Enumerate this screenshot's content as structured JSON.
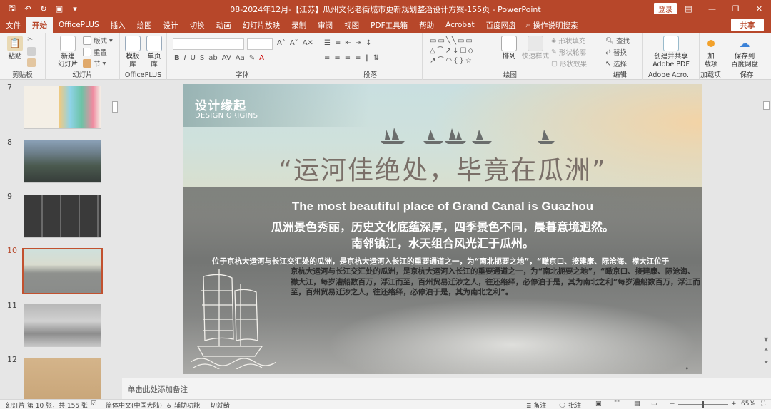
{
  "window": {
    "title": "08-2024年12月-【江苏】瓜州文化老街城市更新规划整治设计方案-155页  -  PowerPoint",
    "login": "登录",
    "share": "共享"
  },
  "tabs": [
    "文件",
    "开始",
    "OfficePLUS",
    "插入",
    "绘图",
    "设计",
    "切换",
    "动画",
    "幻灯片放映",
    "录制",
    "审阅",
    "视图",
    "PDF工具箱",
    "帮助",
    "Acrobat",
    "百度网盘"
  ],
  "active_tab": "开始",
  "tell_me": "操作说明搜索",
  "ribbon": {
    "clipboard": {
      "label": "剪贴板",
      "paste": "粘贴"
    },
    "slides": {
      "label": "幻灯片",
      "new_slide": "新建\n幻灯片",
      "layout": "版式",
      "reset": "重置",
      "section": "节"
    },
    "officeplus": {
      "label": "OfficePLUS",
      "template": "模板库",
      "single": "单页库"
    },
    "font": {
      "label": "字体"
    },
    "paragraph": {
      "label": "段落"
    },
    "drawing": {
      "label": "绘图",
      "arrange": "排列",
      "quick_styles": "快速样式",
      "fill": "形状填充",
      "outline": "形状轮廓",
      "effects": "形状效果"
    },
    "editing": {
      "label": "编辑",
      "find": "查找",
      "replace": "替换",
      "select": "选择"
    },
    "adobe": {
      "label": "Adobe Acro...",
      "create": "创建并共享\nAdobe PDF"
    },
    "addins": {
      "label": "加载项",
      "add": "加\n载项"
    },
    "save": {
      "label": "保存",
      "baidu": "保存到\n百度网盘"
    }
  },
  "thumbnails": [
    {
      "num": "7"
    },
    {
      "num": "8"
    },
    {
      "num": "9"
    },
    {
      "num": "10",
      "active": true
    },
    {
      "num": "11"
    },
    {
      "num": "12"
    }
  ],
  "slide": {
    "title": "设计缘起",
    "subtitle": "DESIGN ORIGINS",
    "quote": "“运河佳绝处，毕竟在瓜洲”",
    "english": "The most beautiful place of Grand Canal is Guazhou",
    "cn_line1": "瓜洲景色秀丽，历史文化底蕴深厚，四季景色不同，晨暮意境迥然。",
    "cn_line2": "南邻镇江，水天组合风光汇于瓜州。",
    "para_line1": "位于京杭大运河与长江交汇处的瓜洲，是京杭大运河入长江的重要通道之一，为“南北扼要之地”，“瞰京口、接建康、际沧海、襟大江",
    "para_line1_tail": "位于",
    "para_body": "京杭大运河与长江交汇处的瓜洲，是京杭大运河入长江的重要通道之一，为“南北扼要之地”，“瞰京口、接建康、际沧海、襟大江，每岁漕船数百万，浮江而至，百州贸易迁涉之人，往还络绎，必停泊于是，其为南北之利”每岁漕船数百万，浮江而至，百州贸易迁涉之人，往还络绎，必停泊于是，其为南北之利”。"
  },
  "notes_placeholder": "单击此处添加备注",
  "status": {
    "slide_info": "幻灯片 第 10 张，共 155 张",
    "language": "简体中文(中国大陆)",
    "accessibility": "辅助功能: 一切就绪",
    "notes": "备注",
    "comments": "批注",
    "zoom": "65%"
  },
  "colors": {
    "accent": "#b7472a",
    "ribbon_bg": "#f3f3f3"
  }
}
